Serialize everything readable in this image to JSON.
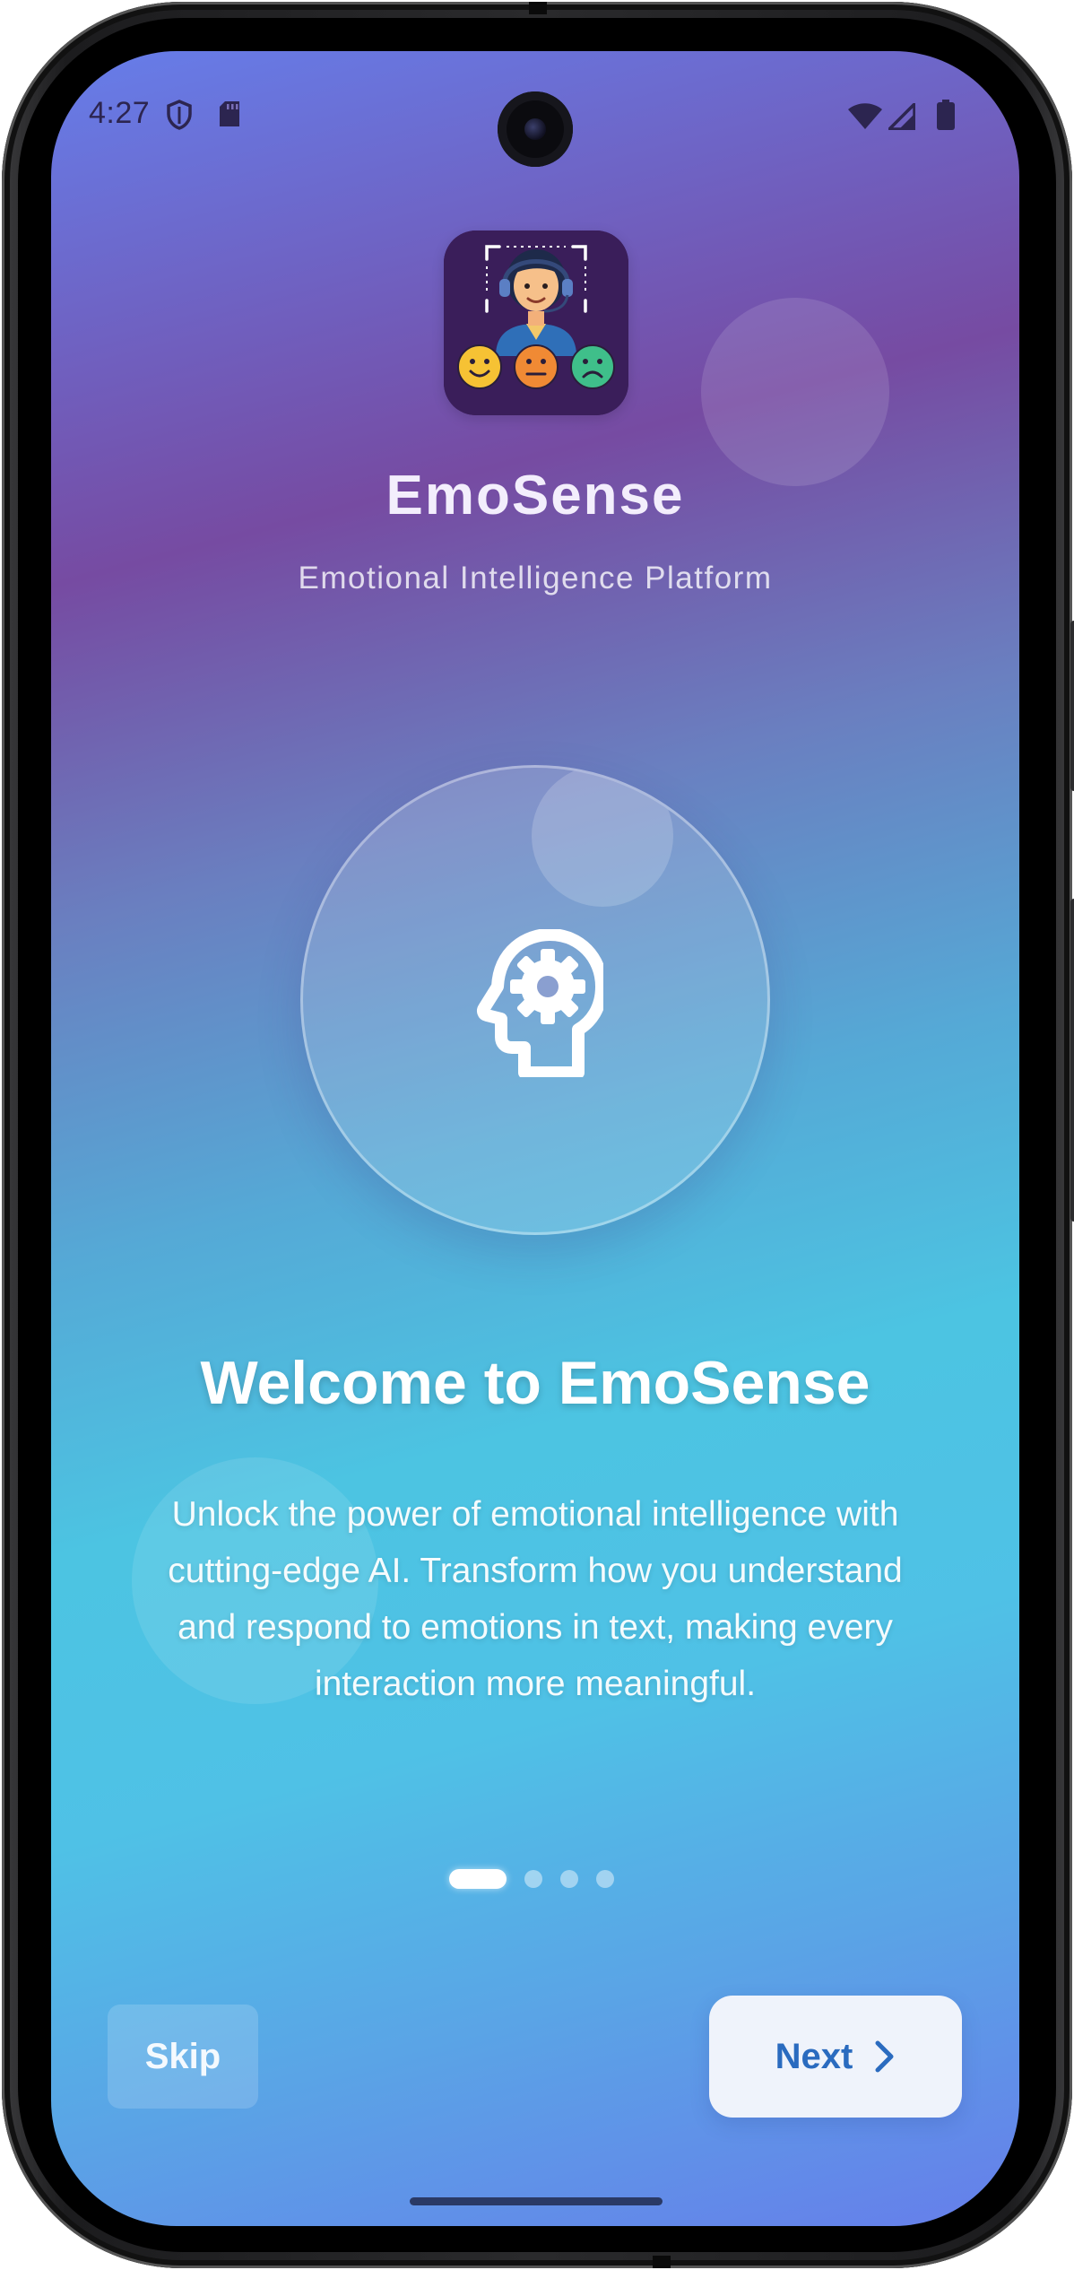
{
  "status_bar": {
    "time": "4:27",
    "left_icons": [
      "shield-icon",
      "sd-card-icon"
    ],
    "right_icons": [
      "wifi-icon",
      "cellular-signal-icon",
      "battery-icon"
    ]
  },
  "app": {
    "name": "EmoSense",
    "tagline": "Emotional Intelligence Platform",
    "logo_icon": "emotion-agent-logo-icon"
  },
  "hero": {
    "icon": "psychology-head-gear-icon"
  },
  "onboarding": {
    "title": "Welcome to EmoSense",
    "description": "Unlock the power of emotional intelligence with cutting-edge AI. Transform how you understand and respond to emotions in text, making every interaction more meaningful.",
    "total_pages": 4,
    "current_page": 1
  },
  "actions": {
    "skip_label": "Skip",
    "next_label": "Next",
    "next_icon": "chevron-right-icon"
  },
  "colors": {
    "gradient": [
      "#667eea",
      "#764ba2",
      "#4cc4e2",
      "#667eea"
    ],
    "next_text": "#2a6bbf",
    "next_bg": "#eff3fb"
  }
}
